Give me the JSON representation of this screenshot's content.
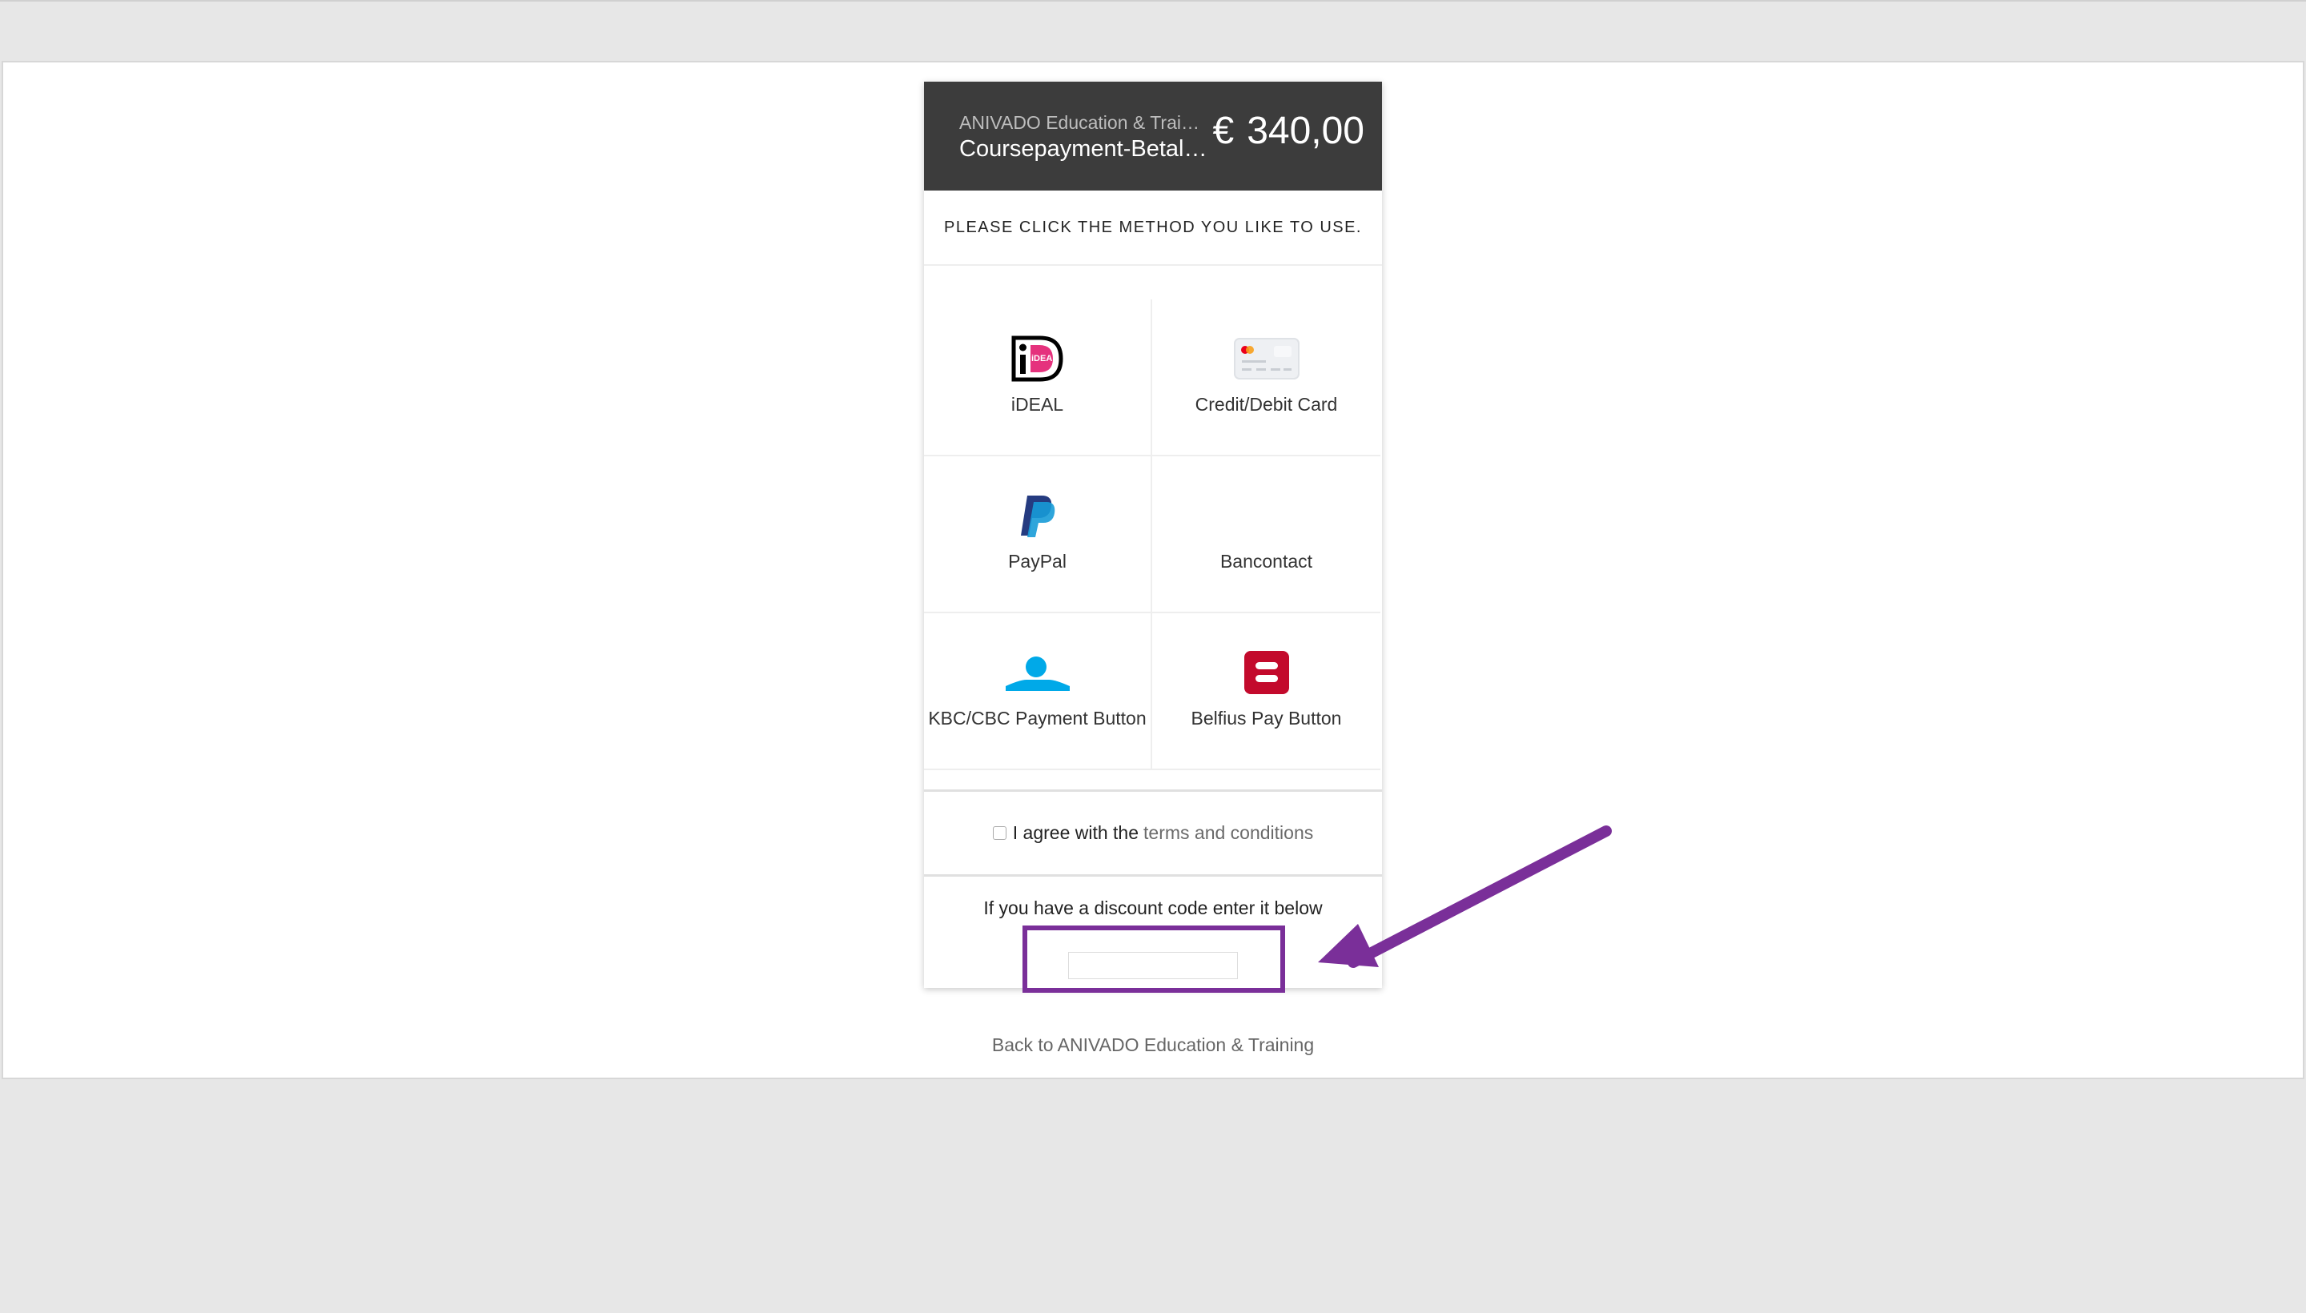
{
  "header": {
    "merchant": "ANIVADO Education & Training",
    "product": "Coursepayment-Betaling",
    "currency_symbol": "€",
    "amount": "340,00"
  },
  "instruction": "PLEASE CLICK THE METHOD YOU LIKE TO USE.",
  "methods": [
    {
      "label": "iDEAL",
      "icon": "ideal-icon"
    },
    {
      "label": "Credit/Debit Card",
      "icon": "credit-card-icon"
    },
    {
      "label": "PayPal",
      "icon": "paypal-icon"
    },
    {
      "label": "Bancontact",
      "icon": "bancontact-icon"
    },
    {
      "label": "KBC/CBC Payment Button",
      "icon": "kbc-icon"
    },
    {
      "label": "Belfius Pay Button",
      "icon": "belfius-icon"
    }
  ],
  "agreement": {
    "text": "I agree with the",
    "link": "terms and conditions",
    "checked": false
  },
  "discount": {
    "label": "If you have a discount code enter it below",
    "value": "",
    "placeholder": ""
  },
  "back_link": "Back to ANIVADO Education & Training",
  "colors": {
    "header_bg": "#3c3c3c",
    "annotation": "#7a2f99",
    "ideal_pink": "#e5327d",
    "paypal_dark": "#253b80",
    "paypal_light": "#179bd7",
    "kbc_blue": "#00a9e8",
    "belfius_red": "#c30a2c"
  }
}
